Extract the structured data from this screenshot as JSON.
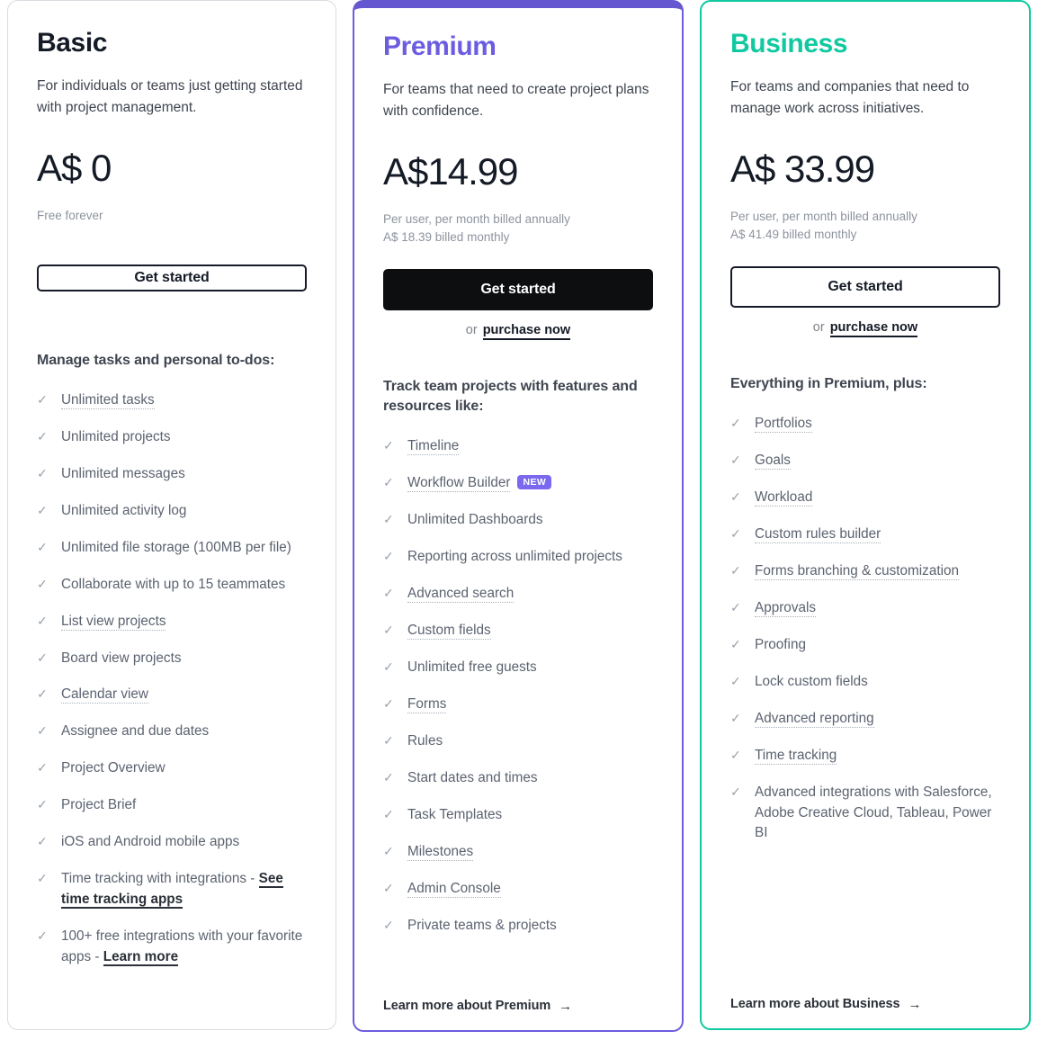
{
  "colors": {
    "premium_accent": "#6c5ce0",
    "business_accent": "#10c9a0",
    "badge_purple": "#7a68ee",
    "basic_border": "#d8dce0",
    "text_dark": "#151b26",
    "text_muted": "#8d939e"
  },
  "plans": [
    {
      "id": "basic",
      "name": "Basic",
      "description": "For individuals or teams just getting started with project management.",
      "price": "A$ 0",
      "billing_lines": [
        "Free forever"
      ],
      "cta_label": "Get started",
      "purchase_prefix": "",
      "purchase_label": "",
      "features_title": "Manage tasks and personal to-dos:",
      "features": [
        {
          "text": "Unlimited tasks",
          "style": "tooltip"
        },
        {
          "text": "Unlimited projects",
          "style": "plain"
        },
        {
          "text": "Unlimited messages",
          "style": "plain"
        },
        {
          "text": "Unlimited activity log",
          "style": "plain"
        },
        {
          "text": "Unlimited file storage (100MB per file)",
          "style": "plain"
        },
        {
          "text": "Collaborate with up to 15 teammates",
          "style": "plain"
        },
        {
          "text": "List view projects",
          "style": "tooltip"
        },
        {
          "text": "Board view projects",
          "style": "plain"
        },
        {
          "text": "Calendar view",
          "style": "tooltip"
        },
        {
          "text": "Assignee and due dates",
          "style": "plain"
        },
        {
          "text": "Project Overview",
          "style": "plain"
        },
        {
          "text": "Project Brief",
          "style": "plain"
        },
        {
          "text": "iOS and Android mobile apps",
          "style": "plain"
        },
        {
          "text": "Time tracking with integrations - ",
          "style": "plain-plus-link",
          "link": "See time tracking apps"
        },
        {
          "text": "100+ free integrations with your favorite apps - ",
          "style": "plain-plus-link",
          "link": "Learn more"
        }
      ],
      "footer_link": "",
      "footer_arrow": ""
    },
    {
      "id": "premium",
      "name": "Premium",
      "description": "For teams that need to create project plans with confidence.",
      "price": "A$14.99",
      "billing_lines": [
        "Per user, per month billed annually",
        "A$ 18.39 billed monthly"
      ],
      "cta_label": "Get started",
      "purchase_prefix": "or",
      "purchase_label": "purchase now",
      "features_title": "Track team projects with features and resources like:",
      "features": [
        {
          "text": "Timeline",
          "style": "tooltip"
        },
        {
          "text": "Workflow Builder",
          "style": "tooltip",
          "badge": "NEW"
        },
        {
          "text": "Unlimited Dashboards",
          "style": "plain"
        },
        {
          "text": "Reporting across unlimited projects",
          "style": "plain"
        },
        {
          "text": "Advanced search",
          "style": "tooltip"
        },
        {
          "text": "Custom fields",
          "style": "tooltip"
        },
        {
          "text": "Unlimited free guests",
          "style": "plain"
        },
        {
          "text": "Forms",
          "style": "tooltip"
        },
        {
          "text": "Rules",
          "style": "plain"
        },
        {
          "text": "Start dates and times",
          "style": "plain"
        },
        {
          "text": "Task Templates",
          "style": "plain"
        },
        {
          "text": "Milestones",
          "style": "tooltip"
        },
        {
          "text": "Admin Console",
          "style": "tooltip"
        },
        {
          "text": "Private teams & projects",
          "style": "plain"
        }
      ],
      "footer_link": "Learn more about Premium",
      "footer_arrow": "→"
    },
    {
      "id": "business",
      "name": "Business",
      "description": "For teams and companies that need to manage work across initiatives.",
      "price": "A$ 33.99",
      "billing_lines": [
        "Per user, per month billed annually",
        "A$ 41.49 billed monthly"
      ],
      "cta_label": "Get started",
      "purchase_prefix": "or",
      "purchase_label": "purchase now",
      "features_title": "Everything in Premium, plus:",
      "features": [
        {
          "text": "Portfolios",
          "style": "tooltip"
        },
        {
          "text": "Goals",
          "style": "tooltip"
        },
        {
          "text": "Workload",
          "style": "tooltip"
        },
        {
          "text": "Custom rules builder",
          "style": "tooltip"
        },
        {
          "text": "Forms branching & customization",
          "style": "tooltip"
        },
        {
          "text": "Approvals",
          "style": "tooltip"
        },
        {
          "text": "Proofing",
          "style": "plain"
        },
        {
          "text": "Lock custom fields",
          "style": "plain"
        },
        {
          "text": "Advanced reporting",
          "style": "tooltip"
        },
        {
          "text": "Time tracking",
          "style": "tooltip"
        },
        {
          "text": "Advanced integrations with Salesforce, Adobe Creative Cloud, Tableau, Power BI",
          "style": "plain"
        }
      ],
      "footer_link": "Learn more about Business",
      "footer_arrow": "→"
    }
  ],
  "icons": {
    "check": "✓",
    "arrow_right": "→"
  }
}
